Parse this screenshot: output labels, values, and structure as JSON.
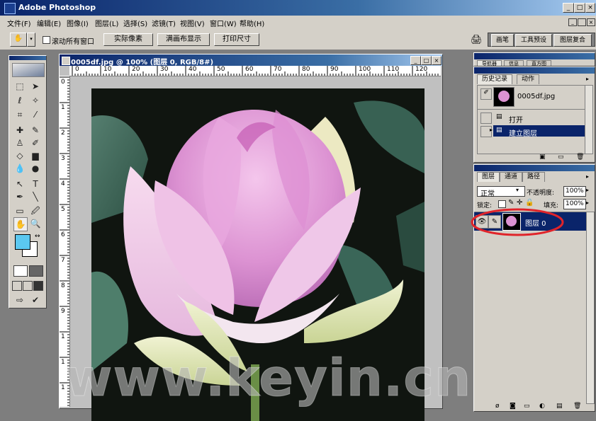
{
  "window": {
    "title": "Adobe Photoshop",
    "minimize": "_",
    "maximize": "□",
    "close": "×"
  },
  "menu": [
    "文件(F)",
    "编辑(E)",
    "图像(I)",
    "图层(L)",
    "选择(S)",
    "滤镜(T)",
    "视图(V)",
    "窗口(W)",
    "帮助(H)"
  ],
  "options_bar": {
    "checkbox_label": "滚动所有窗口",
    "buttons": [
      "实际像素",
      "满画布显示",
      "打印尺寸"
    ],
    "palette_well_tabs": [
      "画笔",
      "工具预设",
      "图层复合"
    ]
  },
  "document": {
    "title": "0005df.jpg @ 100% (图层 0, RGB/8#)",
    "ruler_top_labels": [
      "0",
      "10",
      "20",
      "30",
      "40",
      "50",
      "60",
      "70",
      "80",
      "90",
      "100",
      "110",
      "120"
    ],
    "ruler_left_labels": [
      "0",
      "1",
      "2",
      "3",
      "4",
      "5",
      "6",
      "7",
      "8",
      "9",
      "1",
      "1",
      "1"
    ]
  },
  "navigator_panel": {
    "tabs": [
      "导航器",
      "信息",
      "直方图"
    ]
  },
  "history_panel": {
    "tabs": [
      "历史记录",
      "动作"
    ],
    "snapshot": "0005df.jpg",
    "items": [
      {
        "label": "打开",
        "selected": false
      },
      {
        "label": "建立图层",
        "selected": true
      }
    ]
  },
  "layers_panel": {
    "tabs": [
      "图层",
      "通道",
      "路径"
    ],
    "blend_mode": "正常",
    "opacity_label": "不透明度:",
    "opacity_value": "100%",
    "lock_label": "锁定:",
    "fill_label": "填充:",
    "fill_value": "100%",
    "layer_name": "图层 0",
    "highlight_color": "#e0242a"
  },
  "foreground_color": "#5bc8f0",
  "background_color": "#ffffff",
  "watermark": "www.keyin.cn"
}
